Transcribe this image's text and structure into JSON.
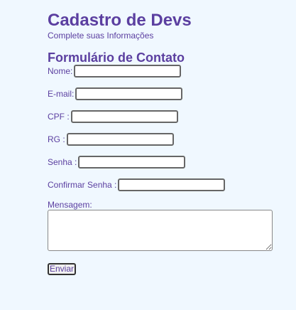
{
  "header": {
    "title": "Cadastro de Devs",
    "subtitle": "Complete suas Informações"
  },
  "form": {
    "section_title": "Formulário de Contato",
    "fields": [
      {
        "label": "Nome:",
        "value": "",
        "placeholder": ""
      },
      {
        "label": "E-mail:",
        "value": "",
        "placeholder": ""
      },
      {
        "label": "CPF :",
        "value": "",
        "placeholder": ""
      },
      {
        "label": "RG :",
        "value": "",
        "placeholder": ""
      },
      {
        "label": "Senha :",
        "value": "",
        "placeholder": ""
      },
      {
        "label": "Confirmar Senha :",
        "value": "",
        "placeholder": ""
      }
    ],
    "message_label": "Mensagem:",
    "message_value": "",
    "submit_label": "Enviar"
  },
  "colors": {
    "background": "#f0f8ff",
    "text": "#5b3fa0"
  }
}
